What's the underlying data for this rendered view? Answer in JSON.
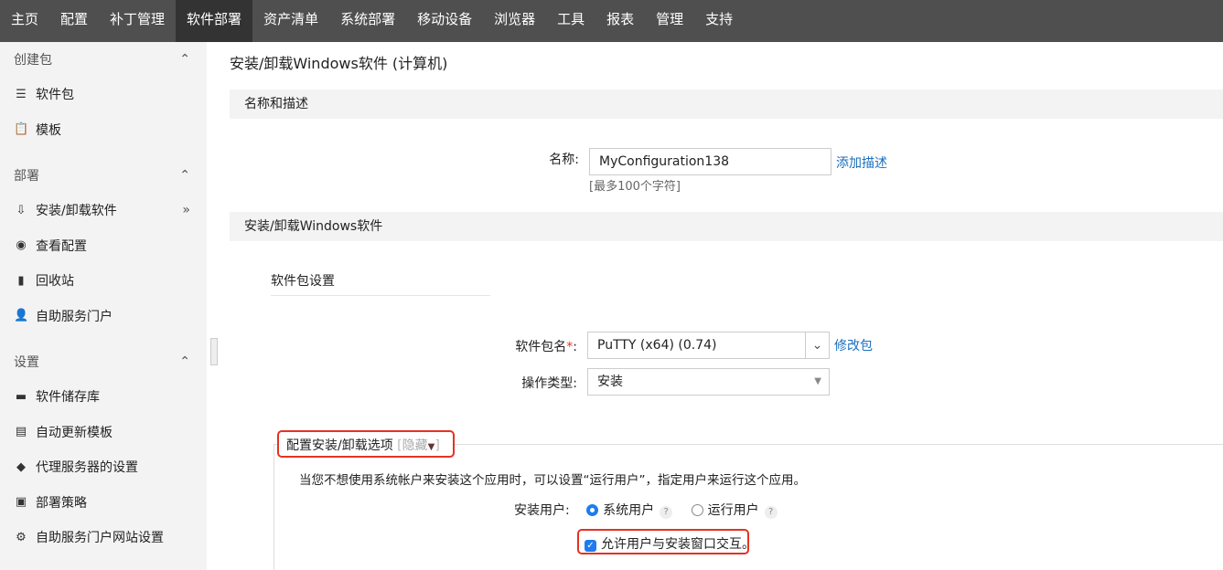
{
  "nav": [
    "主页",
    "配置",
    "补丁管理",
    "软件部署",
    "资产清单",
    "系统部署",
    "移动设备",
    "浏览器",
    "工具",
    "报表",
    "管理",
    "支持"
  ],
  "sidebar": {
    "sections": [
      {
        "label": "创建包",
        "items": [
          {
            "label": "软件包",
            "icon": "package-icon"
          },
          {
            "label": "模板",
            "icon": "clipboard-icon"
          }
        ]
      },
      {
        "label": "部署",
        "items": [
          {
            "label": "安装/卸载软件",
            "icon": "install-icon"
          },
          {
            "label": "查看配置",
            "icon": "eye-icon"
          },
          {
            "label": "回收站",
            "icon": "trash-icon"
          },
          {
            "label": "自助服务门户",
            "icon": "user-icon"
          }
        ]
      },
      {
        "label": "设置",
        "items": [
          {
            "label": "软件储存库",
            "icon": "folder-icon"
          },
          {
            "label": "自动更新模板",
            "icon": "template-icon"
          },
          {
            "label": "代理服务器的设置",
            "icon": "proxy-icon"
          },
          {
            "label": "部署策略",
            "icon": "policy-icon"
          },
          {
            "label": "自助服务门户网站设置",
            "icon": "user-settings-icon"
          }
        ]
      }
    ]
  },
  "main": {
    "title": "安装/卸载Windows软件 (计算机)",
    "name_section": "名称和描述",
    "name_label": "名称:",
    "name_value": "MyConfiguration138",
    "add_desc": "添加描述",
    "name_hint": "[最多100个字符]",
    "install_section": "安装/卸载Windows软件",
    "pkg_settings": "软件包设置",
    "pkg_label": "软件包名",
    "required": "*",
    "colon": ":",
    "pkg_value": "PuTTY (x64) (0.74)",
    "modify_pkg": "修改包",
    "op_label": "操作类型:",
    "op_value": "安装",
    "options_title": "配置安装/卸载选项",
    "hide_open": "[",
    "hide": "隐藏",
    "hide_close": "]",
    "options_desc": "当您不想使用系统帐户来安装这个应用时，可以设置“运行用户”，指定用户来运行这个应用。",
    "install_user_label": "安装用户:",
    "system_user": "系统用户",
    "run_user": "运行用户",
    "help": "?",
    "allow_interact": "允许用户与安装窗口交互。"
  }
}
